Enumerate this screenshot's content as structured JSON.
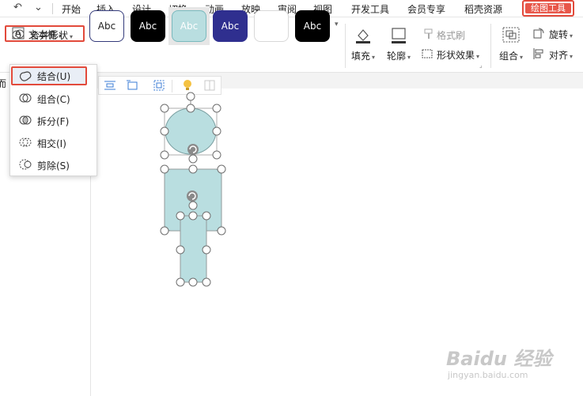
{
  "menubar": {
    "quick_access": [
      "↶",
      "⌄"
    ],
    "items": [
      "开始",
      "插入",
      "设计",
      "切换",
      "动画",
      "放映",
      "审阅",
      "视图",
      "开发工具",
      "会员专享",
      "稻壳资源"
    ],
    "active_tab": "绘图工具"
  },
  "ribbon": {
    "textbox_label": "文本框",
    "merge_shapes_label": "合并形状",
    "style_samples": [
      {
        "text": "Abc",
        "bg": "#ffffff",
        "fg": "#222222",
        "border": "#333a7a"
      },
      {
        "text": "Abc",
        "bg": "#000000",
        "fg": "#ffffff",
        "border": "#000000"
      },
      {
        "text": "Abc",
        "bg": "#b9dee0",
        "fg": "#ffffff",
        "border": "#7ab9bd"
      },
      {
        "text": "Abc",
        "bg": "#2f2f8f",
        "fg": "#ffffff",
        "border": "#2f2f8f"
      },
      {
        "text": "",
        "bg": "#ffffff",
        "fg": "#222222",
        "border": "#d8d8d8"
      },
      {
        "text": "Abc",
        "bg": "#000000",
        "fg": "#ffffff",
        "border": "#000000"
      }
    ],
    "fill_label": "填充",
    "outline_label": "轮廓",
    "format_painter_label": "格式刷",
    "shape_effects_label": "形状效果",
    "group_label": "组合",
    "rotate_label": "旋转",
    "align_label": "对齐"
  },
  "left_strip": {
    "partial_char": "而"
  },
  "dropdown": {
    "items": [
      {
        "label": "结合(U)",
        "icon": "union-icon",
        "highlighted": true
      },
      {
        "label": "组合(C)",
        "icon": "combine-icon",
        "highlighted": false
      },
      {
        "label": "拆分(F)",
        "icon": "fragment-icon",
        "highlighted": false
      },
      {
        "label": "相交(I)",
        "icon": "intersect-icon",
        "highlighted": false
      },
      {
        "label": "剪除(S)",
        "icon": "subtract-icon",
        "highlighted": false
      }
    ]
  },
  "colors": {
    "accent_red": "#e24a3b",
    "shape_fill": "#b9dee0",
    "shape_stroke": "#7a9ea0"
  },
  "watermark": {
    "brand": "Baidu 经验",
    "url": "jingyan.baidu.com"
  }
}
